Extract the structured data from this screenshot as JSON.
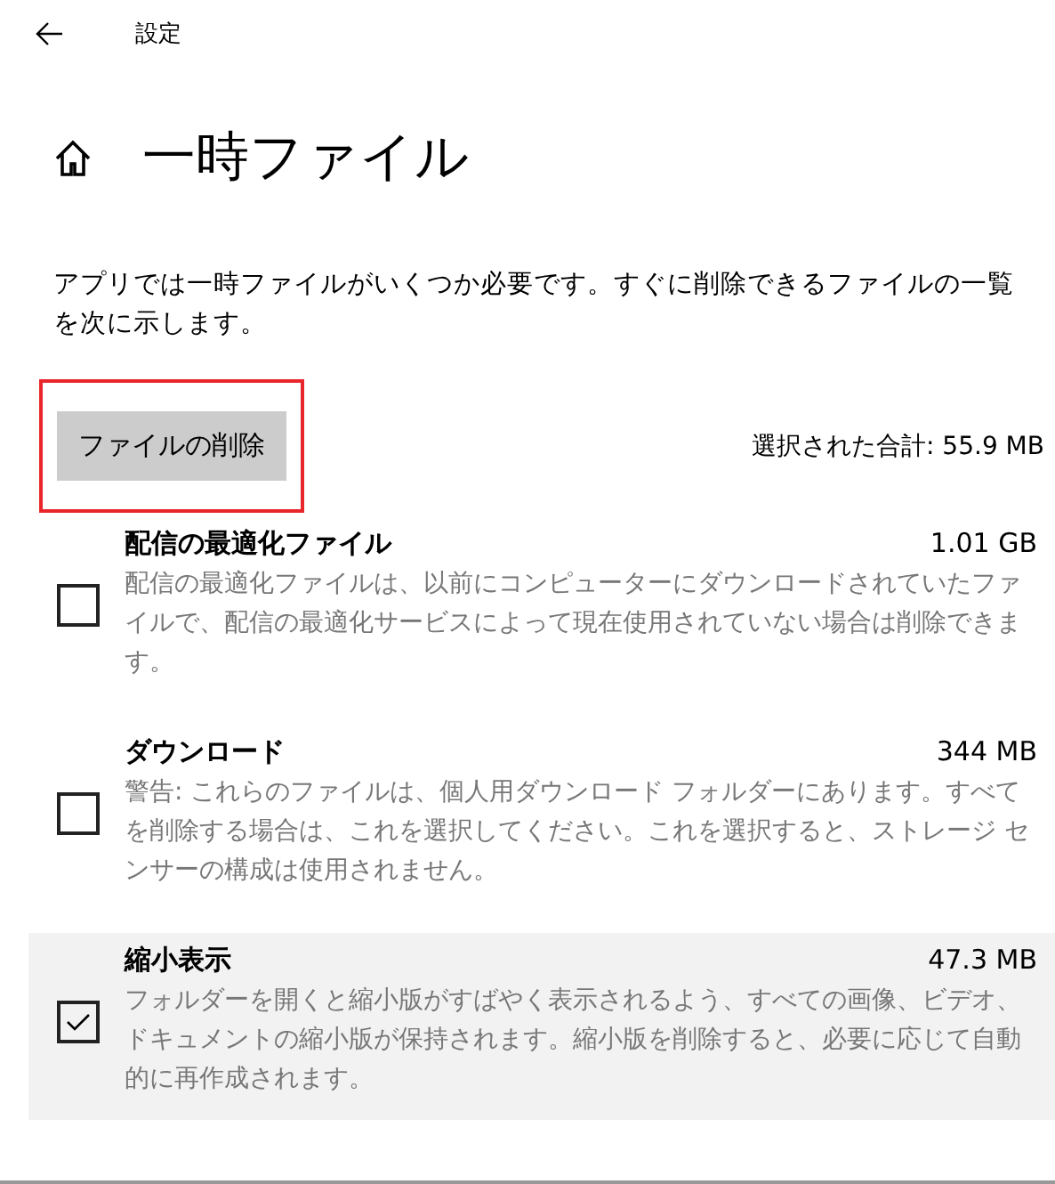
{
  "header": {
    "title": "設定"
  },
  "page": {
    "title": "一時ファイル",
    "description": "アプリでは一時ファイルがいくつか必要です。すぐに削除できるファイルの一覧を次に示します。"
  },
  "delete_button": {
    "label": "ファイルの削除",
    "highlighted": true
  },
  "total": "選択された合計: 55.9 MB",
  "items": [
    {
      "title": "配信の最適化ファイル",
      "size": "1.01 GB",
      "description": "配信の最適化ファイルは、以前にコンピューターにダウンロードされていたファイルで、配信の最適化サービスによって現在使用されていない場合は削除できます。",
      "checked": false,
      "hovered": false
    },
    {
      "title": "ダウンロード",
      "size": "344 MB",
      "description": "警告: これらのファイルは、個人用ダウンロード フォルダーにあります。すべてを削除する場合は、これを選択してください。これを選択すると、ストレージ センサーの構成は使用されません。",
      "checked": false,
      "hovered": false
    },
    {
      "title": "縮小表示",
      "size": "47.3 MB",
      "description": "フォルダーを開くと縮小版がすばやく表示されるよう、すべての画像、ビデオ、ドキュメントの縮小版が保持されます。縮小版を削除すると、必要に応じて自動的に再作成されます。",
      "checked": true,
      "hovered": true
    }
  ]
}
